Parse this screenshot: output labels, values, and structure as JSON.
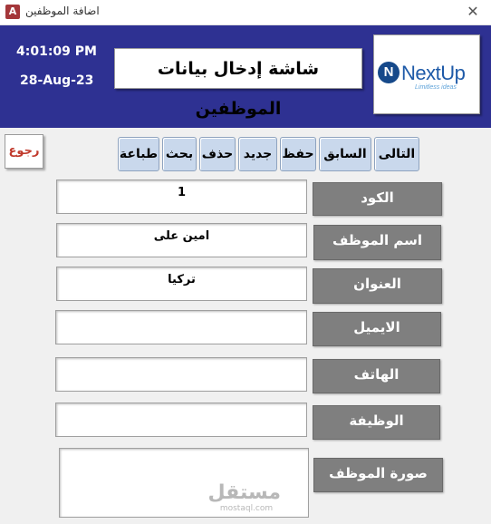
{
  "window": {
    "title": "اضافة الموظفين",
    "app_icon": "A",
    "close_glyph": "✕"
  },
  "header": {
    "time": "4:01:09 PM",
    "date": "28-Aug-23",
    "title": "شاشة إدخال بيانات الموظفين",
    "logo": {
      "mark": "N",
      "name": "NextUp",
      "tagline": "Limitless ideas"
    },
    "background_color": "#2e3192"
  },
  "toolbar": {
    "next": "التالى",
    "previous": "السابق",
    "save": "حفظ",
    "new": "جديد",
    "delete": "حذف",
    "search": "بحث",
    "print": "طباعة",
    "back": "رجوع"
  },
  "form": {
    "code": {
      "label": "الكود",
      "value": "1"
    },
    "name": {
      "label": "اسم الموظف",
      "value": "امين على"
    },
    "address": {
      "label": "العنوان",
      "value": "تركيا"
    },
    "email": {
      "label": "الايميل",
      "value": ""
    },
    "phone": {
      "label": "الهاتف",
      "value": ""
    },
    "job": {
      "label": "الوظيفة",
      "value": ""
    },
    "photo": {
      "label": "صورة الموظف"
    }
  },
  "watermark": {
    "arabic": "مستقل",
    "latin": "mostaql.com"
  }
}
